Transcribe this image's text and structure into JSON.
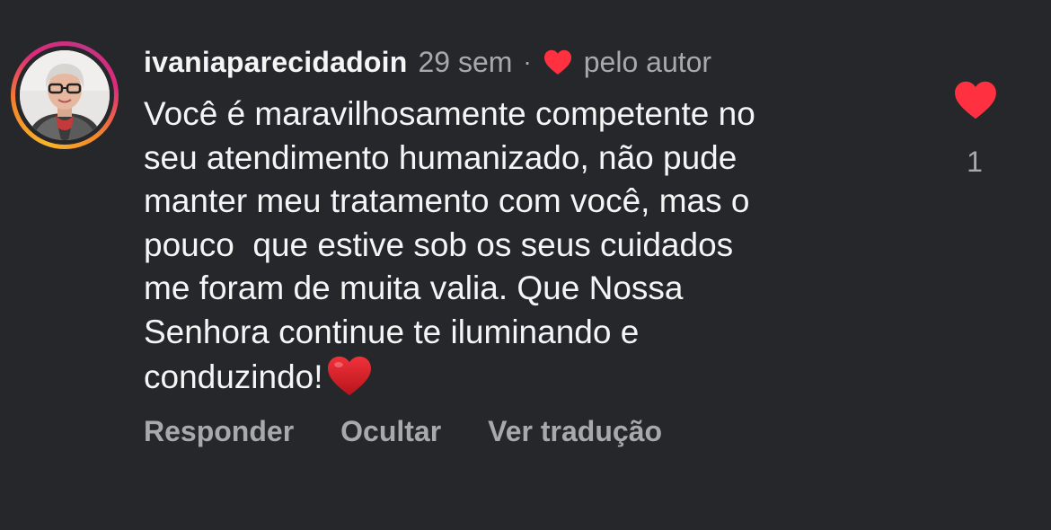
{
  "comment": {
    "username": "ivaniaparecidadoin",
    "time_ago": "29 sem",
    "separator": "·",
    "liked_by_author_label": "pelo autor",
    "text_lines": [
      "Você é maravilhosamente competente no",
      "seu atendimento humanizado, não pude",
      "manter meu tratamento com você, mas o",
      "pouco  que estive sob os seus cuidados",
      "me foram de muita valia. Que Nossa",
      "Senhora continue te iluminando e",
      "conduzindo!"
    ],
    "trailing_emoji": "red-heart-emoji",
    "actions": {
      "reply": "Responder",
      "hide": "Ocultar",
      "translate": "Ver tradução"
    },
    "like": {
      "icon": "heart-filled-icon",
      "count": "1",
      "liked": true
    }
  },
  "colors": {
    "background": "#26272b",
    "text_primary": "#f5f5f5",
    "text_secondary": "#a8a8ad",
    "like_red": "#ff3040",
    "story_ring": [
      "#f7b52b",
      "#f58529",
      "#dd2a7b",
      "#c13584"
    ]
  }
}
